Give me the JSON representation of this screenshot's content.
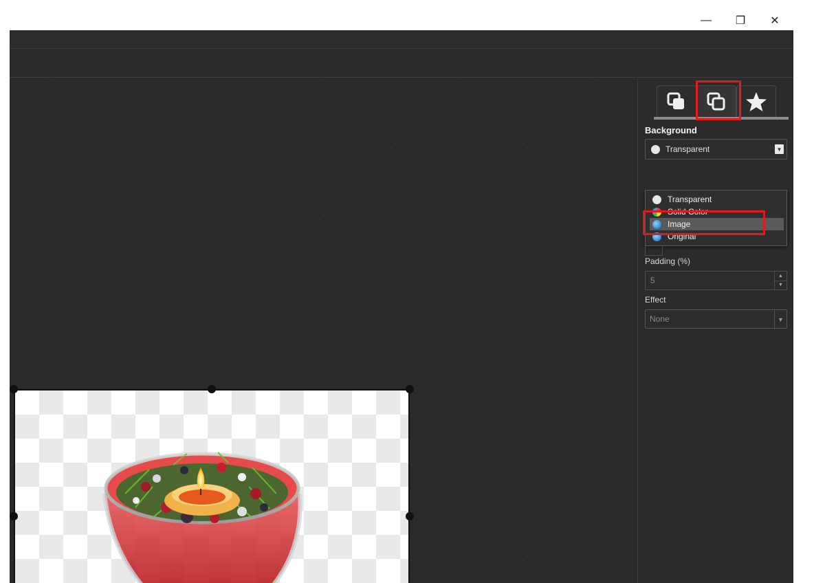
{
  "window_controls": {
    "minimize": "—",
    "maximize": "❐",
    "close": "✕"
  },
  "panel": {
    "tabs": [
      {
        "name": "layers",
        "icon": "overlapping-squares-filled-icon"
      },
      {
        "name": "background",
        "icon": "overlapping-squares-outline-icon",
        "active": true
      },
      {
        "name": "effects",
        "icon": "star-icon"
      }
    ],
    "background_label": "Background",
    "background_select": {
      "value": "Transparent"
    },
    "background_options": [
      "Transparent",
      "Solid Color",
      "Image",
      "Original"
    ],
    "background_selected_option": "Image",
    "padding_label": "Padding (%)",
    "padding_value": "5",
    "effect_label": "Effect",
    "effect_value": "None"
  },
  "colors": {
    "highlight": "#e01b1b",
    "app_background": "#2a2a2a"
  }
}
